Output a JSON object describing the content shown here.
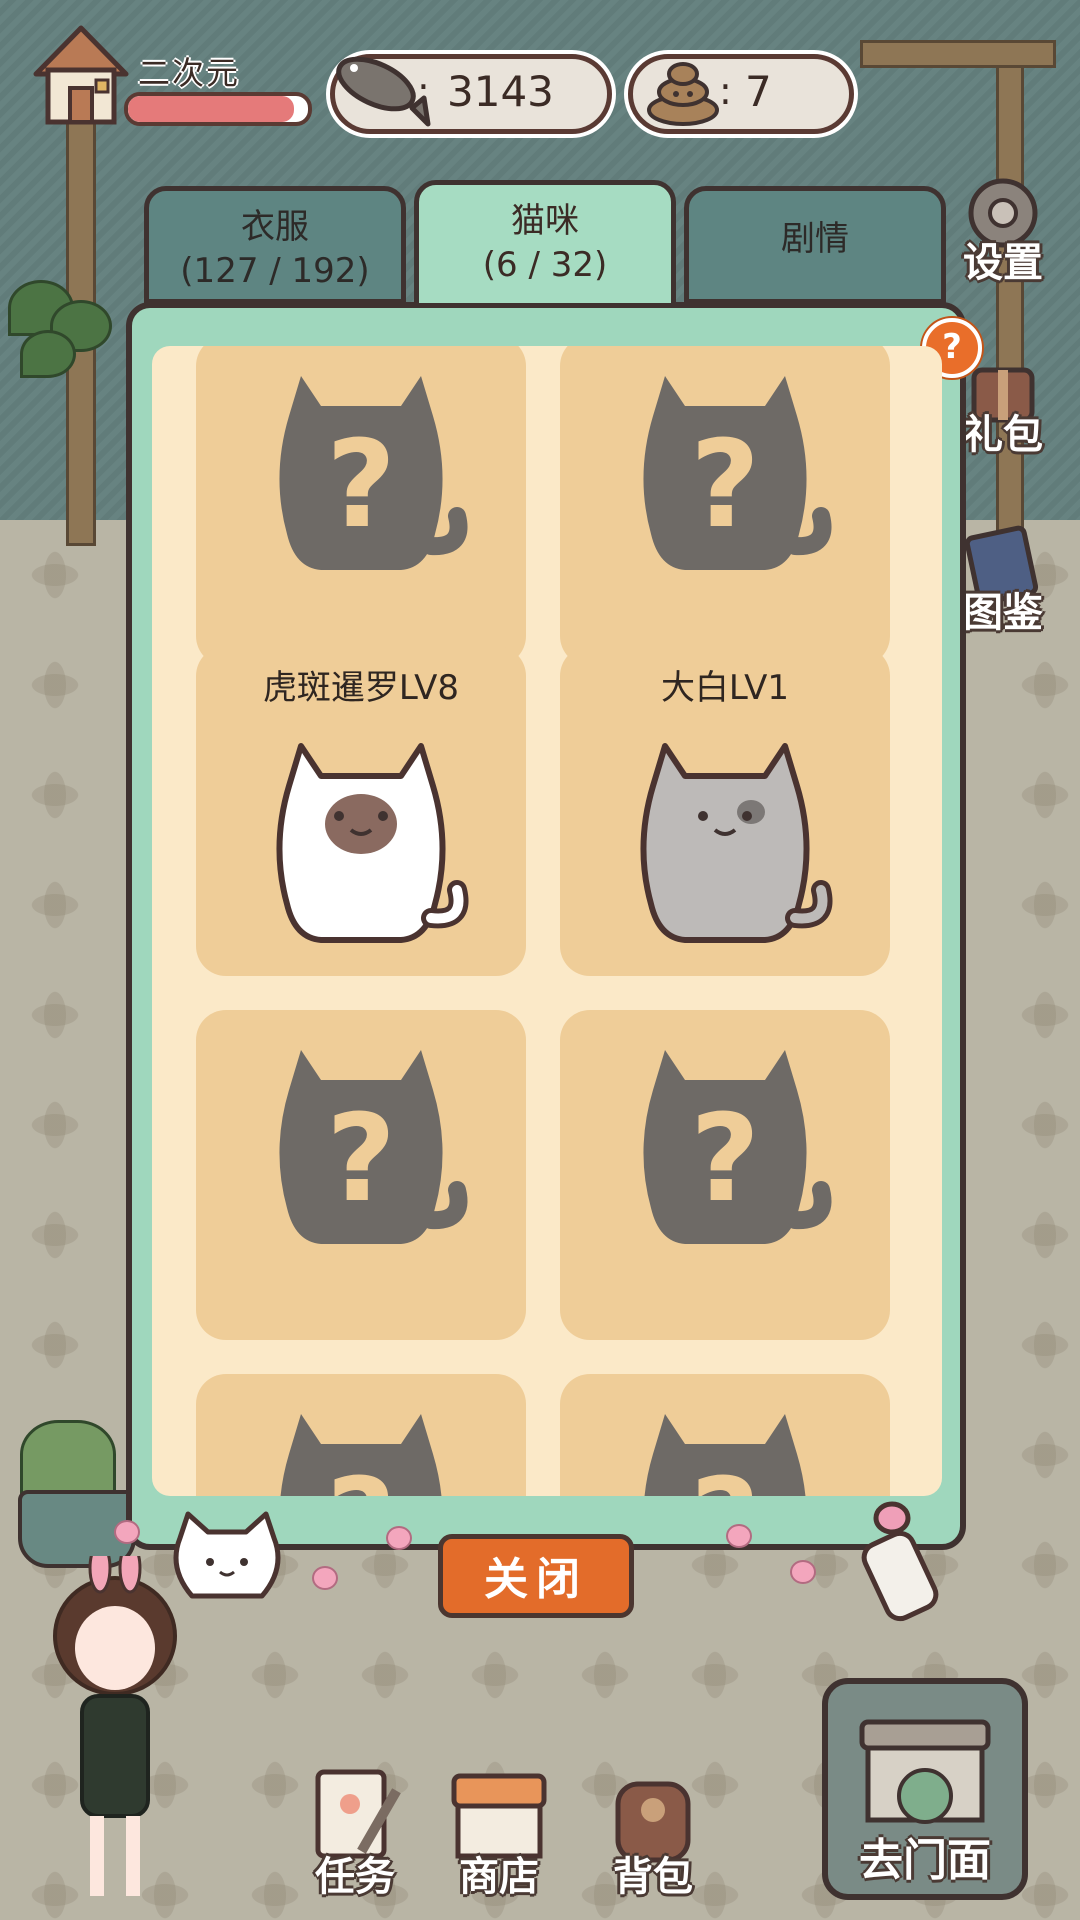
{
  "top_bar": {
    "username": "二次元",
    "xp_fraction": 0.92,
    "fish_value": "3143",
    "poop_value": "7"
  },
  "side_buttons": [
    {
      "label": "设置",
      "icon": "gear-icon"
    },
    {
      "label": "礼包",
      "icon": "gift-icon"
    },
    {
      "label": "图鉴",
      "icon": "book-icon"
    }
  ],
  "tabs": [
    {
      "label": "衣服",
      "count": "(127 / 192)",
      "active": false
    },
    {
      "label": "猫咪",
      "count": "(6 / 32)",
      "active": true
    },
    {
      "label": "剧情",
      "count": "",
      "active": false
    }
  ],
  "help_label": "?",
  "cards": [
    {
      "name": "",
      "state": "locked"
    },
    {
      "name": "",
      "state": "locked"
    },
    {
      "name": "虎斑暹罗LV8",
      "state": "siamese"
    },
    {
      "name": "大白LV1",
      "state": "grey"
    },
    {
      "name": "",
      "state": "locked"
    },
    {
      "name": "",
      "state": "locked"
    },
    {
      "name": "",
      "state": "locked"
    },
    {
      "name": "",
      "state": "locked"
    }
  ],
  "close_label": "关闭",
  "dock": [
    {
      "label": "任务",
      "icon": "task-icon"
    },
    {
      "label": "商店",
      "icon": "shop-icon"
    },
    {
      "label": "背包",
      "icon": "backpack-icon"
    }
  ],
  "store_label": "去门面",
  "colors": {
    "panel": "#9fd7bd",
    "inner": "#fbe9c8",
    "card": "#efcd98",
    "close": "#e36c2a",
    "tab_inactive": "#5e8582"
  }
}
